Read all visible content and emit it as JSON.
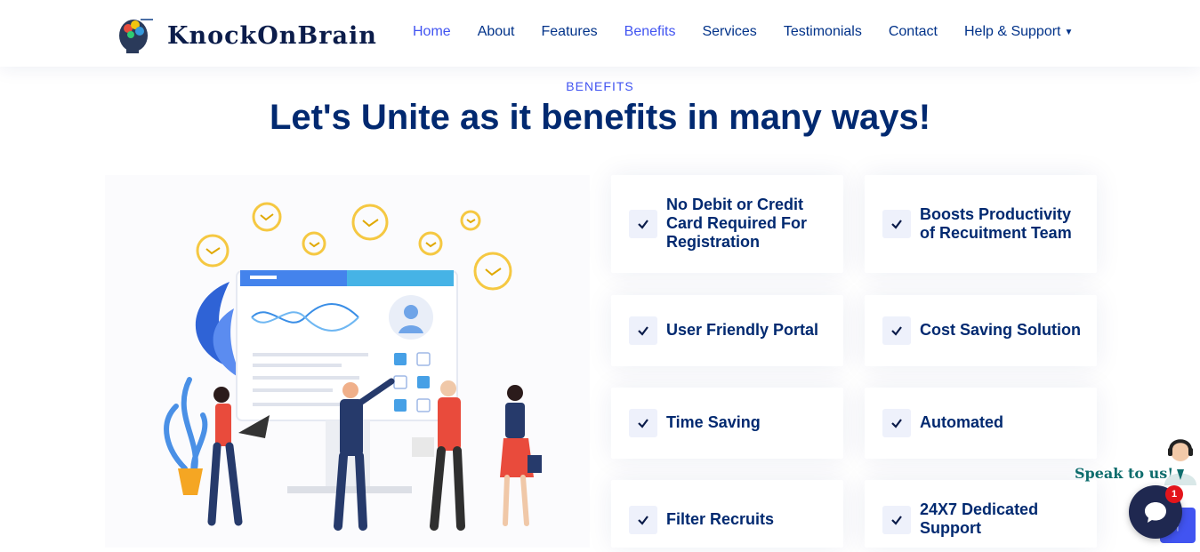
{
  "brand": {
    "name": "KnockOnBrain",
    "logo_icon": "brain-head-icon"
  },
  "nav": {
    "items": [
      {
        "label": "Home",
        "active": true
      },
      {
        "label": "About",
        "active": false
      },
      {
        "label": "Features",
        "active": false
      },
      {
        "label": "Benefits",
        "active": true
      },
      {
        "label": "Services",
        "active": false
      },
      {
        "label": "Testimonials",
        "active": false
      },
      {
        "label": "Contact",
        "active": false
      },
      {
        "label": "Help & Support",
        "active": false,
        "dropdown": true
      }
    ]
  },
  "section": {
    "label": "BENEFITS",
    "title": "Let's Unite as it benefits in many ways!"
  },
  "benefits": [
    {
      "text": "No Debit or Credit Card Required For Registration",
      "icon": "check-icon"
    },
    {
      "text": "Boosts Productivity of Recuitment Team",
      "icon": "check-icon"
    },
    {
      "text": "User Friendly Portal",
      "icon": "check-icon"
    },
    {
      "text": "Cost Saving Solution",
      "icon": "check-icon"
    },
    {
      "text": "Time Saving",
      "icon": "check-icon"
    },
    {
      "text": "Automated",
      "icon": "check-icon"
    },
    {
      "text": "Filter Recruits",
      "icon": "check-icon"
    },
    {
      "text": "24X7 Dedicated Support",
      "icon": "check-icon"
    }
  ],
  "chat": {
    "speak_label": "Speak to us!",
    "unread_count": "1",
    "icon": "chat-bubble-icon"
  },
  "colors": {
    "primary": "#4154f1",
    "navy": "#012970",
    "check_bg": "#eef1fb"
  }
}
